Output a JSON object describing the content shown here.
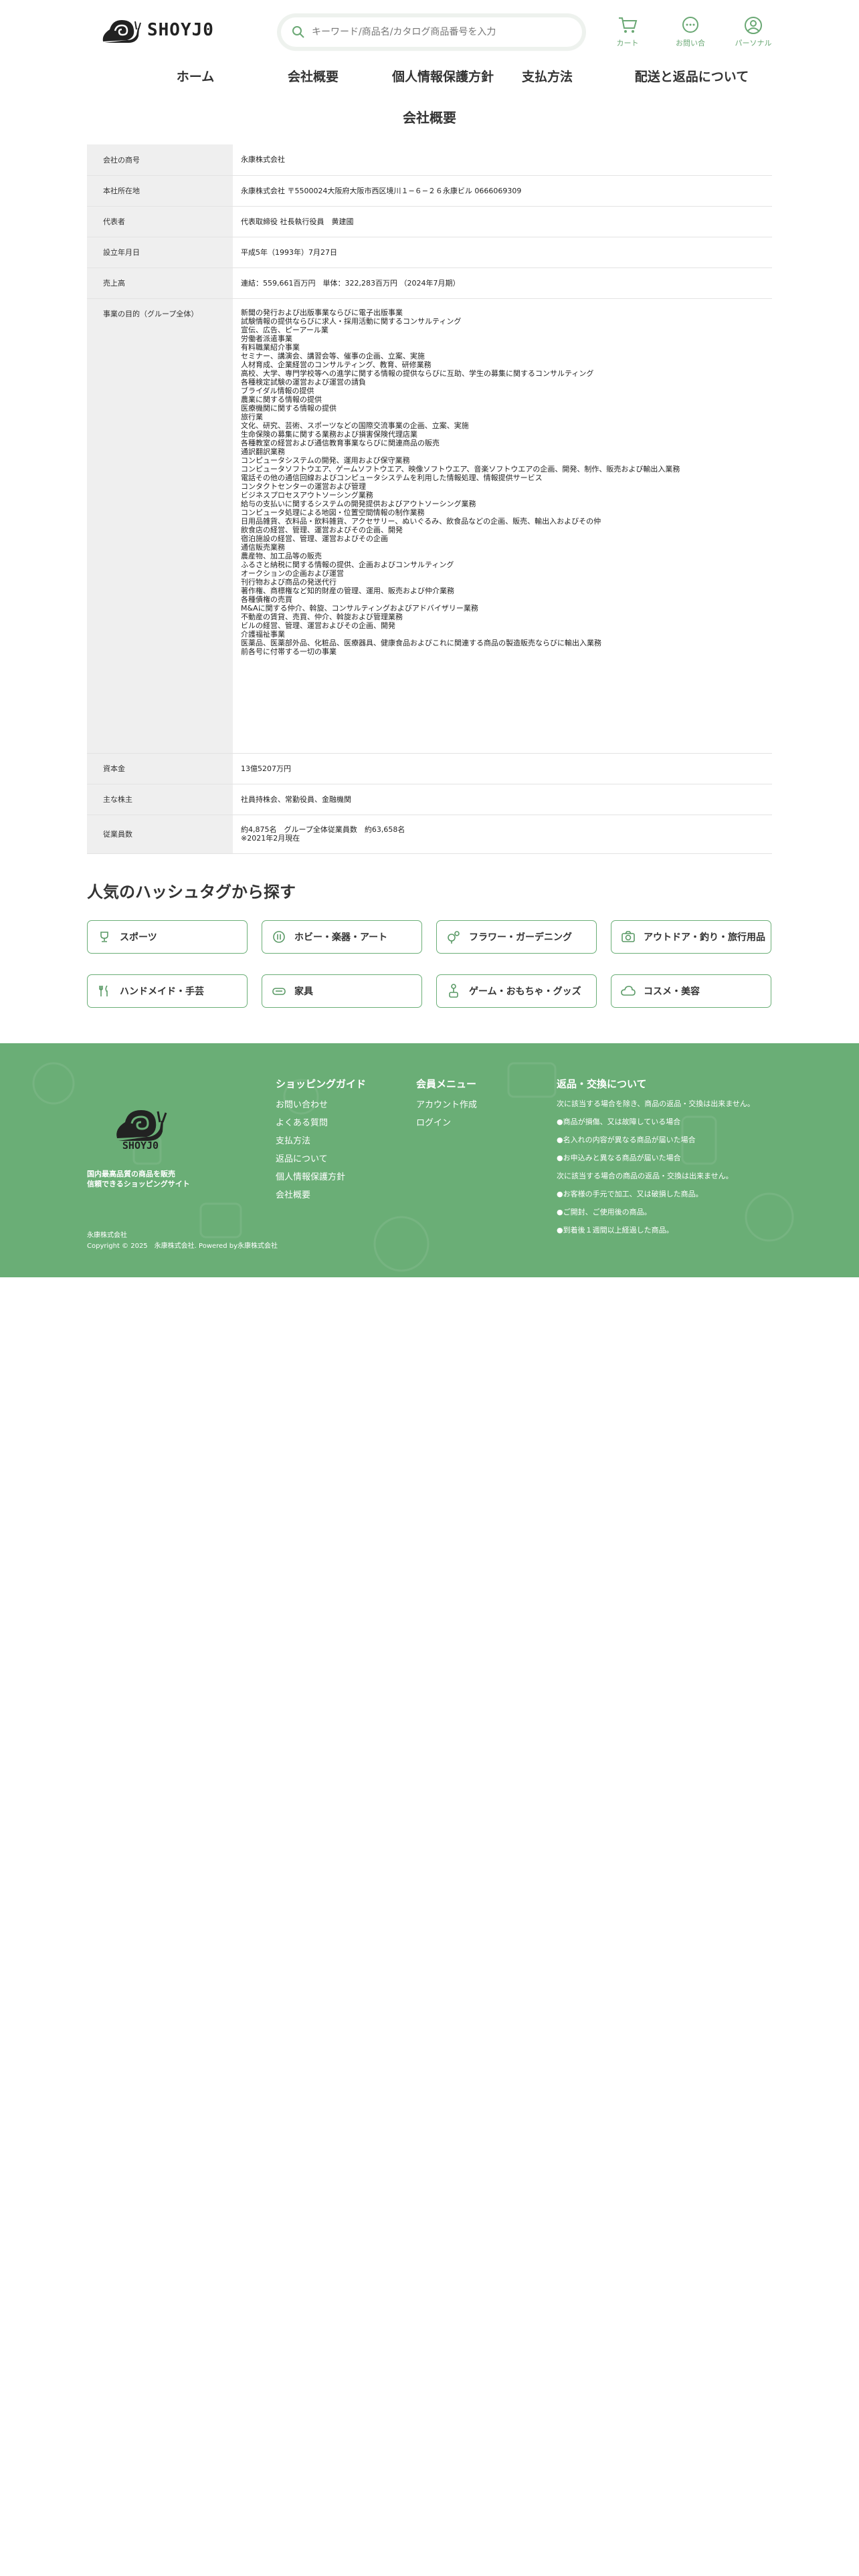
{
  "header": {
    "logo_text": "SHOYJ0",
    "search_placeholder": "キーワード/商品名/カタログ商品番号を入力",
    "icons": [
      {
        "name": "cart-icon",
        "label": "カート"
      },
      {
        "name": "chat-icon",
        "label": "お問い合"
      },
      {
        "name": "user-icon",
        "label": "パーソナル"
      }
    ],
    "nav": [
      "ホーム",
      "会社概要",
      "個人情報保護方針",
      "支払方法",
      "配送と返品について"
    ]
  },
  "page_title": "会社概要",
  "company_table": [
    {
      "label": "会社の商号",
      "value": [
        "永康株式会社"
      ]
    },
    {
      "label": "本社所在地",
      "value": [
        "永康株式会社 〒5500024大阪府大阪市西区境川１−６−２６永康ビル 0666069309"
      ]
    },
    {
      "label": "代表者",
      "value": [
        "代表取締役 社長執行役員　黄建國"
      ]
    },
    {
      "label": "設立年月日",
      "value": [
        "平成5年（1993年）7月27日"
      ]
    },
    {
      "label": "売上高",
      "value": [
        "連結：559,661百万円　単体：322,283百万円 （2024年7月期）"
      ]
    },
    {
      "label": "事業の目的（グループ全体）",
      "value": [
        "新聞の発行および出版事業ならびに電子出版事業",
        "試験情報の提供ならびに求人・採用活動に関するコンサルティング",
        "宣伝、広告、ピーアール業",
        "労働者派遣事業",
        "有料職業紹介事業",
        "セミナー、講演会、講習会等、催事の企画、立案、実施",
        "人材育成、企業経営のコンサルティング、教育、研修業務",
        "高校、大学、専門学校等への進学に関する情報の提供ならびに互助、学生の募集に関するコンサルティング",
        "各種検定試験の運営および運営の請負",
        "ブライダル情報の提供",
        "農業に関する情報の提供",
        "医療機関に関する情報の提供",
        "旅行業",
        "文化、研究、芸術、スポーツなどの国際交流事業の企画、立案、実施",
        "生命保険の募集に関する業務および損害保険代理店業",
        "各種教室の経営および通信教育事業ならびに関連商品の販売",
        "通訳翻訳業務",
        "コンピュータシステムの開発、運用および保守業務",
        "コンピュータソフトウエア、ゲームソフトウエア、映像ソフトウエア、音楽ソフトウエアの企画、開発、制作、販売および輸出入業務",
        "電話その他の通信回線およびコンピュータシステムを利用した情報処理、情報提供サービス",
        "コンタクトセンターの運営および管理",
        "ビジネスプロセスアウトソーシング業務",
        "給与の支払いに関するシステムの開発提供およびアウトソーシング業務",
        "コンピュータ処理による地図・位置空間情報の制作業務",
        "日用品雑貨、衣料品・飲料雑貨、アクセサリー、ぬいぐるみ、飲食品などの企画、販売、輸出入およびその仲",
        "飲食店の経営、管理、運営およびその企画、開発",
        "宿泊施設の経営、管理、運営およびその企画",
        "通信販売業務",
        "農産物、加工品等の販売",
        "ふるさと納税に関する情報の提供、企画およびコンサルティング",
        "オークションの企画および運営",
        "刊行物および商品の発送代行",
        "著作権、商標権など知的財産の管理、運用、販売および仲介業務",
        "各種債権の売買",
        "M&Aに関する仲介、斡旋、コンサルティングおよびアドバイザリー業務",
        "不動産の賃貸、売買、仲介、斡旋および管理業務",
        "ビルの経営、管理、運営およびその企画、開発",
        "介護福祉事業",
        "医薬品、医薬部外品、化粧品、医療器具、健康食品およびこれに関連する商品の製造販売ならびに輸出入業務",
        "前各号に付帯する一切の事業"
      ]
    },
    {
      "label": "資本金",
      "value": [
        "13億5207万円"
      ]
    },
    {
      "label": "主な株主",
      "value": [
        "社員持株会、常勤役員、金融機関"
      ]
    },
    {
      "label": "従業員数",
      "value": [
        "約4,875名　グループ全体従業員数　約63,658名",
        "※2021年2月現在"
      ]
    }
  ],
  "hashtag_section": {
    "title": "人気のハッシュタグから探す",
    "tags": [
      {
        "label": "スポーツ",
        "icon": "trophy-icon"
      },
      {
        "label": "ホビー・楽器・アート",
        "icon": "hobby-icon"
      },
      {
        "label": "フラワー・ガーデニング",
        "icon": "flower-icon"
      },
      {
        "label": "アウトドア・釣り・旅行用品",
        "icon": "camera-icon"
      },
      {
        "label": "ハンドメイド・手芸",
        "icon": "utensils-icon"
      },
      {
        "label": "家具",
        "icon": "sofa-icon"
      },
      {
        "label": "ゲーム・おもちゃ・グッズ",
        "icon": "joystick-icon"
      },
      {
        "label": "コスメ・美容",
        "icon": "cloud-icon"
      }
    ]
  },
  "footer": {
    "logo_text": "SHOYJ0",
    "tagline_1": "国内最高品質の商品を販売",
    "tagline_2": "信頼できるショッピングサイト",
    "company": "永康株式会社",
    "copyright": "Copyright © 2025　永康株式会社. Powered by永康株式会社",
    "guide": {
      "title": "ショッピングガイド",
      "links": [
        "お問い合わせ",
        "よくある質問",
        "支払方法",
        "返品について",
        "個人情報保護方針",
        "会社概要"
      ]
    },
    "member": {
      "title": "会員メニュー",
      "links": [
        "アカウント作成",
        "ログイン"
      ]
    },
    "returns": {
      "title": "返品・交換について",
      "lines": [
        "次に該当する場合を除き、商品の返品・交換は出来ません。",
        "●商品が損傷、又は故障している場合",
        "●名入れの内容が異なる商品が届いた場合",
        "●お申込みと異なる商品が届いた場合",
        "次に該当する場合の商品の返品・交換は出来ません。",
        "●お客様の手元で加工、又は破損した商品。",
        "●ご開封、ご使用後の商品。",
        "●到着後１週間以上経過した商品。"
      ]
    }
  }
}
